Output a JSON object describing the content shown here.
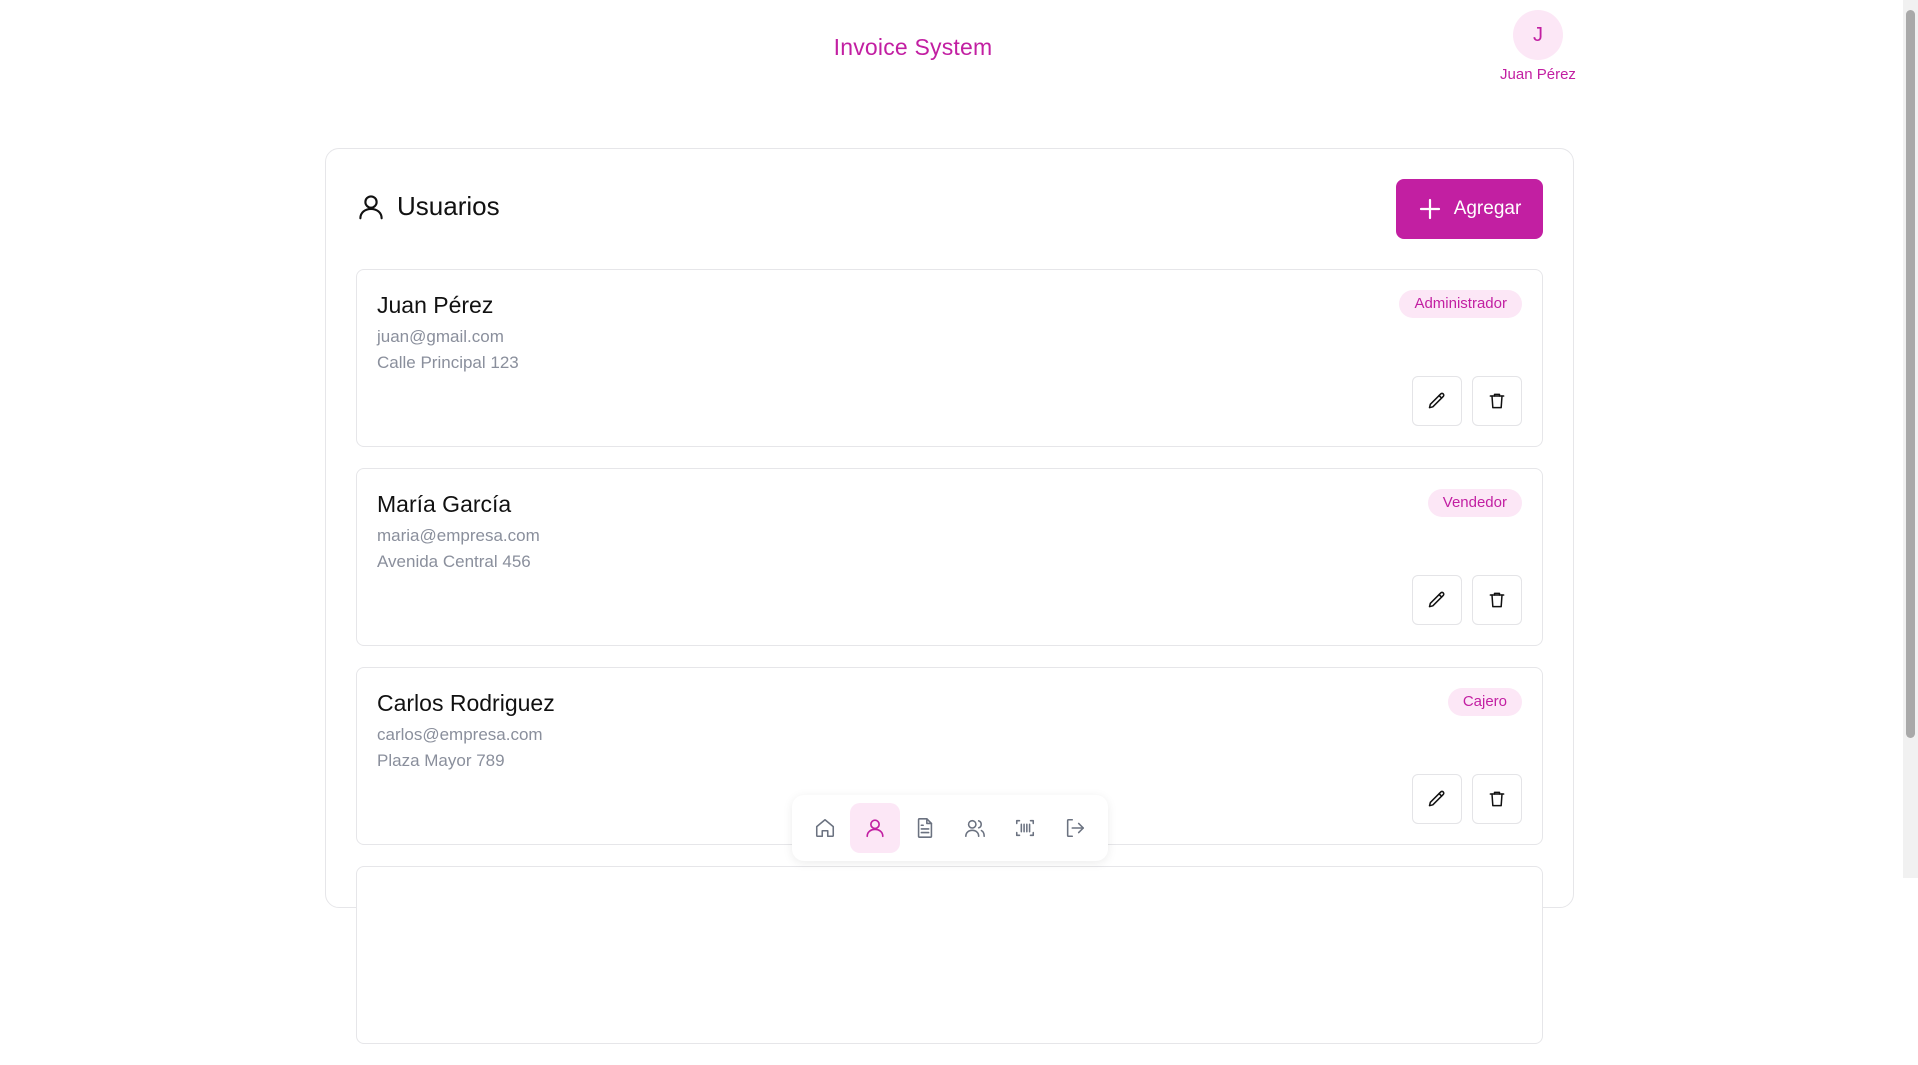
{
  "app": {
    "title": "Invoice System"
  },
  "user": {
    "initial": "J",
    "name": "Juan Pérez"
  },
  "page": {
    "title": "Usuarios",
    "add_label": "Agregar"
  },
  "users": [
    {
      "name": "Juan Pérez",
      "email": "juan@gmail.com",
      "address": "Calle Principal 123",
      "role": "Administrador"
    },
    {
      "name": "María García",
      "email": "maria@empresa.com",
      "address": "Avenida Central 456",
      "role": "Vendedor"
    },
    {
      "name": "Carlos Rodriguez",
      "email": "carlos@empresa.com",
      "address": "Plaza Mayor 789",
      "role": "Cajero"
    },
    {
      "name": "",
      "email": "",
      "address": "",
      "role": ""
    }
  ],
  "nav": {
    "items": [
      {
        "icon": "home-icon",
        "active": false
      },
      {
        "icon": "user-icon",
        "active": true
      },
      {
        "icon": "document-icon",
        "active": false
      },
      {
        "icon": "users-icon",
        "active": false
      },
      {
        "icon": "barcode-scan-icon",
        "active": false
      },
      {
        "icon": "logout-icon",
        "active": false
      }
    ]
  },
  "colors": {
    "accent": "#c21fa2",
    "accent_soft": "#fce7f6",
    "muted_text": "#8a8f9c",
    "border": "#e6e6e9"
  }
}
